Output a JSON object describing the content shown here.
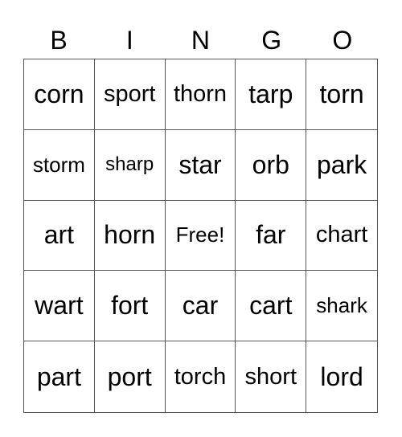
{
  "header": [
    "B",
    "I",
    "N",
    "G",
    "O"
  ],
  "cells": [
    "corn",
    "sport",
    "thorn",
    "tarp",
    "torn",
    "storm",
    "sharp",
    "star",
    "orb",
    "park",
    "art",
    "horn",
    "Free!",
    "far",
    "chart",
    "wart",
    "fort",
    "car",
    "cart",
    "shark",
    "part",
    "port",
    "torch",
    "short",
    "lord"
  ]
}
